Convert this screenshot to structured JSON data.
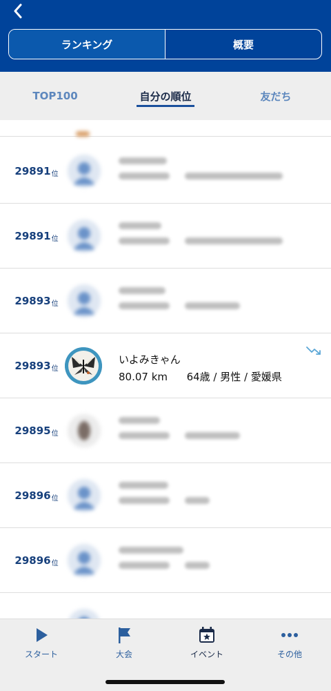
{
  "header": {
    "segments": [
      {
        "label": "ランキング",
        "active": true
      },
      {
        "label": "概要",
        "active": false
      }
    ]
  },
  "subtabs": [
    {
      "label": "TOP100",
      "active": false
    },
    {
      "label": "自分の順位",
      "active": true
    },
    {
      "label": "友だち",
      "active": false
    }
  ],
  "ranking": {
    "rank_suffix": "位",
    "rows": [
      {
        "rank": "29891",
        "blurred": true,
        "avatar": "default-user-icon"
      },
      {
        "rank": "29891",
        "blurred": true,
        "avatar": "default-user-icon"
      },
      {
        "rank": "29893",
        "blurred": true,
        "avatar": "default-user-icon"
      },
      {
        "rank": "29893",
        "blurred": false,
        "avatar": "butterfly-photo",
        "name": "いよみきゃん",
        "distance": "80.07 km",
        "profile": "64歳 / 男性 / 愛媛県",
        "trend": "trending-down-icon"
      },
      {
        "rank": "29895",
        "blurred": true,
        "avatar": "photo"
      },
      {
        "rank": "29896",
        "blurred": true,
        "avatar": "default-user-icon"
      },
      {
        "rank": "29896",
        "blurred": true,
        "avatar": "default-user-icon"
      }
    ]
  },
  "tabbar": {
    "items": [
      {
        "label": "スタート",
        "icon": "play-icon",
        "active": false
      },
      {
        "label": "大会",
        "icon": "flag-icon",
        "active": false
      },
      {
        "label": "イベント",
        "icon": "calendar-star-icon",
        "active": true
      },
      {
        "label": "その他",
        "icon": "more-icon",
        "active": false
      }
    ]
  },
  "colors": {
    "header_bg": "#00439a",
    "rank_text": "#17407c",
    "accent": "#1a4f9c"
  }
}
